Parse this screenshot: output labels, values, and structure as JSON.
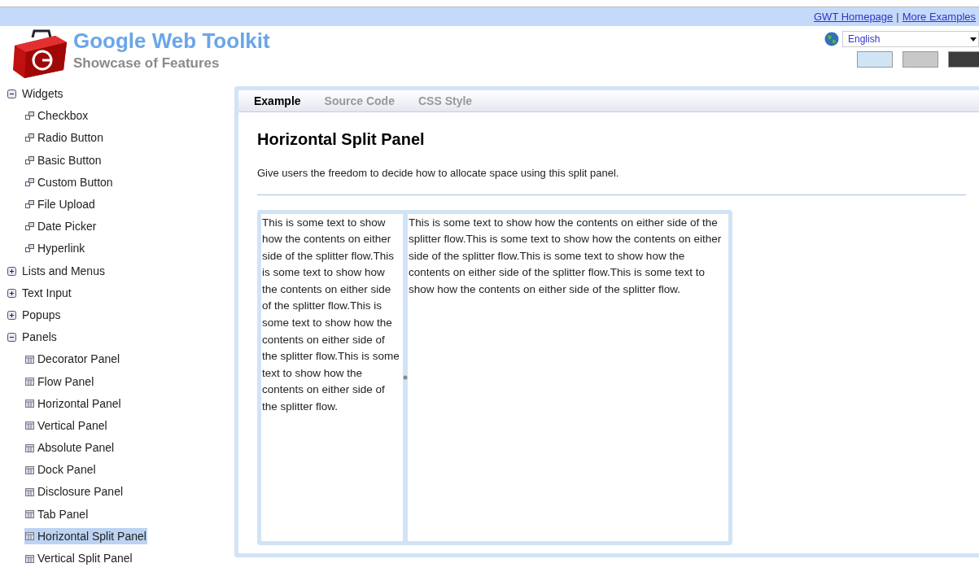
{
  "top_links": [
    {
      "label": "GWT Homepage"
    },
    {
      "label": "More Examples"
    }
  ],
  "top_separator": "|",
  "header": {
    "title": "Google Web Toolkit",
    "subtitle": "Showcase of Features"
  },
  "locale": {
    "value": "English"
  },
  "themes": [
    {
      "color": "#d0e4f6"
    },
    {
      "color": "#c8c8c8"
    },
    {
      "color": "#3c3c3c"
    }
  ],
  "sidebar": {
    "items": [
      {
        "label": "Widgets",
        "expanded": true,
        "children": [
          {
            "label": "Checkbox",
            "kind": "widget",
            "selected": false
          },
          {
            "label": "Radio Button",
            "kind": "widget",
            "selected": false
          },
          {
            "label": "Basic Button",
            "kind": "widget",
            "selected": false
          },
          {
            "label": "Custom Button",
            "kind": "widget",
            "selected": false
          },
          {
            "label": "File Upload",
            "kind": "widget",
            "selected": false
          },
          {
            "label": "Date Picker",
            "kind": "widget",
            "selected": false
          },
          {
            "label": "Hyperlink",
            "kind": "widget",
            "selected": false
          }
        ]
      },
      {
        "label": "Lists and Menus",
        "expanded": false
      },
      {
        "label": "Text Input",
        "expanded": false
      },
      {
        "label": "Popups",
        "expanded": false
      },
      {
        "label": "Panels",
        "expanded": true,
        "children": [
          {
            "label": "Decorator Panel",
            "kind": "panel",
            "selected": false
          },
          {
            "label": "Flow Panel",
            "kind": "panel",
            "selected": false
          },
          {
            "label": "Horizontal Panel",
            "kind": "panel",
            "selected": false
          },
          {
            "label": "Vertical Panel",
            "kind": "panel",
            "selected": false
          },
          {
            "label": "Absolute Panel",
            "kind": "panel",
            "selected": false
          },
          {
            "label": "Dock Panel",
            "kind": "panel",
            "selected": false
          },
          {
            "label": "Disclosure Panel",
            "kind": "panel",
            "selected": false
          },
          {
            "label": "Tab Panel",
            "kind": "panel",
            "selected": false
          },
          {
            "label": "Horizontal Split Panel",
            "kind": "panel",
            "selected": true
          },
          {
            "label": "Vertical Split Panel",
            "kind": "panel",
            "selected": false
          }
        ]
      }
    ]
  },
  "tabs": [
    {
      "label": "Example",
      "selected": true
    },
    {
      "label": "Source Code",
      "selected": false
    },
    {
      "label": "CSS Style",
      "selected": false
    }
  ],
  "content": {
    "title": "Horizontal Split Panel",
    "description": "Give users the freedom to decide how to allocate space using this split panel.",
    "left_pane": "This is some text to show how the contents on either side of the splitter flow.This is some text to show how the contents on either side of the splitter flow.This is some text to show how the contents on either side of the splitter flow.This is some text to show how the contents on either side of the splitter flow.",
    "right_pane": "This is some text to show how the contents on either side of the splitter flow.This is some text to show how the contents on either side of the splitter flow.This is some text to show how the contents on either side of the splitter flow.This is some text to show how the contents on either side of the splitter flow."
  }
}
